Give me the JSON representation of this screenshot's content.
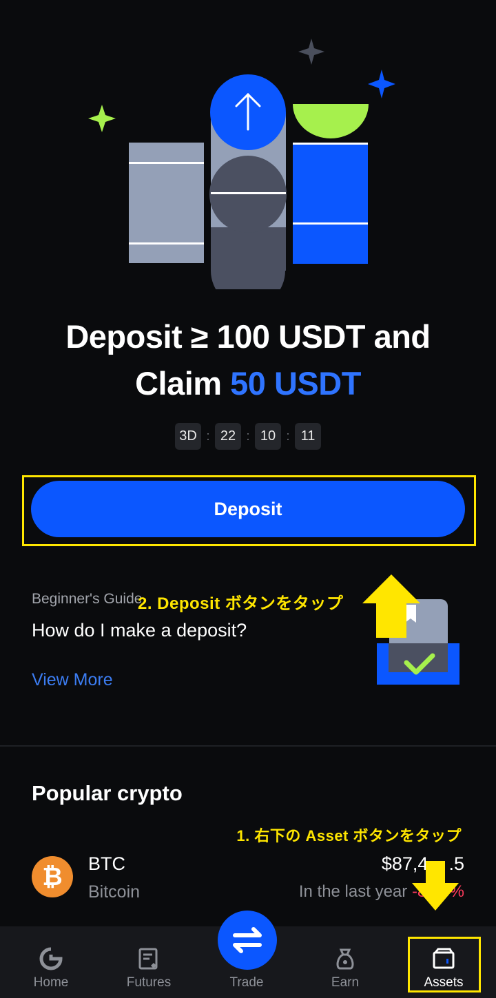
{
  "promo": {
    "headline_part1": "Deposit ≥ 100 USDT and",
    "headline_part2": "Claim",
    "headline_accent": "50 USDT",
    "countdown": {
      "days": "3D",
      "hours": "22",
      "minutes": "10",
      "seconds": "11",
      "separator": ":"
    },
    "deposit_label": "Deposit"
  },
  "guide": {
    "kicker": "Beginner's Guide",
    "title": "How do I make a deposit?",
    "link": "View More"
  },
  "annotations": {
    "step2": "2. Deposit ボタンをタップ",
    "step1": "1. 右下の Asset ボタンをタップ"
  },
  "popular": {
    "title": "Popular crypto",
    "coins": [
      {
        "symbol": "BTC",
        "name": "Bitcoin",
        "icon": "bitcoin-icon",
        "icon_glyph": "₿",
        "price": "$87,4",
        "price_tail": ".5",
        "period": "In the last year",
        "change": "-8",
        "change_tail": "%"
      }
    ]
  },
  "tabs": [
    {
      "label": "Home",
      "icon": "home-icon"
    },
    {
      "label": "Futures",
      "icon": "futures-icon"
    },
    {
      "label": "Trade",
      "icon": "trade-swap-icon"
    },
    {
      "label": "Earn",
      "icon": "earn-bag-icon"
    },
    {
      "label": "Assets",
      "icon": "wallet-icon"
    }
  ],
  "colors": {
    "background": "#0a0b0d",
    "accent_blue": "#0b57ff",
    "link_blue": "#3c7df2",
    "highlight_yellow": "#ffe600",
    "negative_red": "#ff3b5c",
    "bitcoin_orange": "#f08d2e"
  }
}
